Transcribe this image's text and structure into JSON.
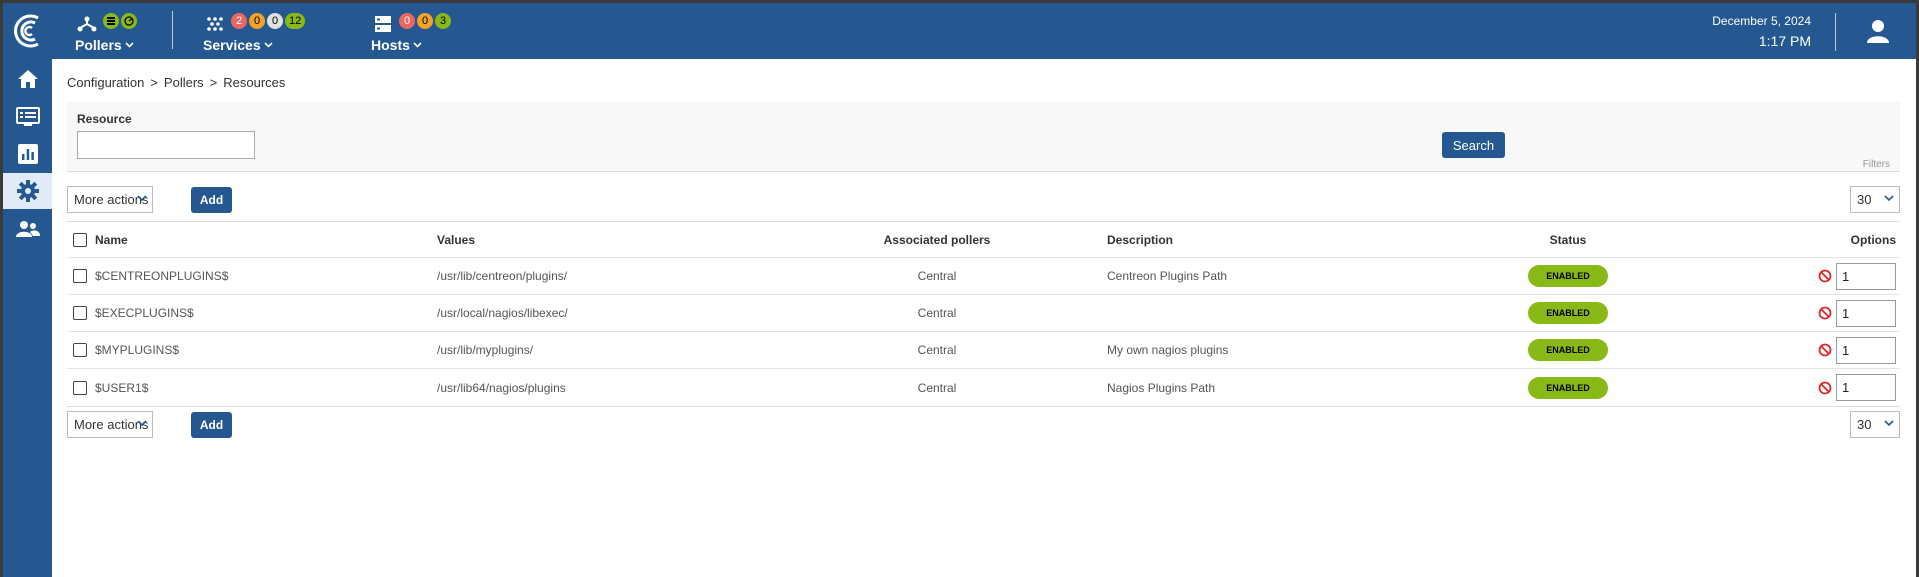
{
  "header": {
    "pollers": {
      "label": "Pollers"
    },
    "services": {
      "label": "Services",
      "badges": [
        "2",
        "0",
        "0",
        "12"
      ]
    },
    "hosts": {
      "label": "Hosts",
      "badges": [
        "0",
        "0",
        "3"
      ]
    },
    "date": "December 5, 2024",
    "time": "1:17 PM"
  },
  "sidebar": {
    "items": [
      {
        "icon": "home-icon"
      },
      {
        "icon": "monitoring-icon"
      },
      {
        "icon": "reporting-icon"
      },
      {
        "icon": "configuration-gear-icon",
        "active": true
      },
      {
        "icon": "administration-users-icon"
      }
    ]
  },
  "breadcrumb": [
    "Configuration",
    ">",
    "Pollers",
    ">",
    "Resources"
  ],
  "filters": {
    "resource_label": "Resource",
    "resource_value": "",
    "search_label": "Search",
    "filters_label": "Filters"
  },
  "toolbar": {
    "more_actions": "More actions",
    "add": "Add",
    "per_page": "30"
  },
  "table": {
    "columns": {
      "name": "Name",
      "values": "Values",
      "pollers": "Associated pollers",
      "description": "Description",
      "status": "Status",
      "options": "Options"
    },
    "rows": [
      {
        "name": "$CENTREONPLUGINS$",
        "values": "/usr/lib/centreon/plugins/",
        "pollers": "Central",
        "description": "Centreon Plugins Path",
        "status": "ENABLED",
        "option": "1"
      },
      {
        "name": "$EXECPLUGINS$",
        "values": "/usr/local/nagios/libexec/",
        "pollers": "Central",
        "description": "",
        "status": "ENABLED",
        "option": "1"
      },
      {
        "name": "$MYPLUGINS$",
        "values": "/usr/lib/myplugins/",
        "pollers": "Central",
        "description": "My own nagios plugins",
        "status": "ENABLED",
        "option": "1"
      },
      {
        "name": "$USER1$",
        "values": "/usr/lib64/nagios/plugins",
        "pollers": "Central",
        "description": "Nagios Plugins Path",
        "status": "ENABLED",
        "option": "1"
      }
    ]
  },
  "colors": {
    "brand": "#255891",
    "enabled": "#88b917",
    "critical": "#ed6762",
    "warning": "#f3a427",
    "unknown": "#e0e0e0"
  }
}
